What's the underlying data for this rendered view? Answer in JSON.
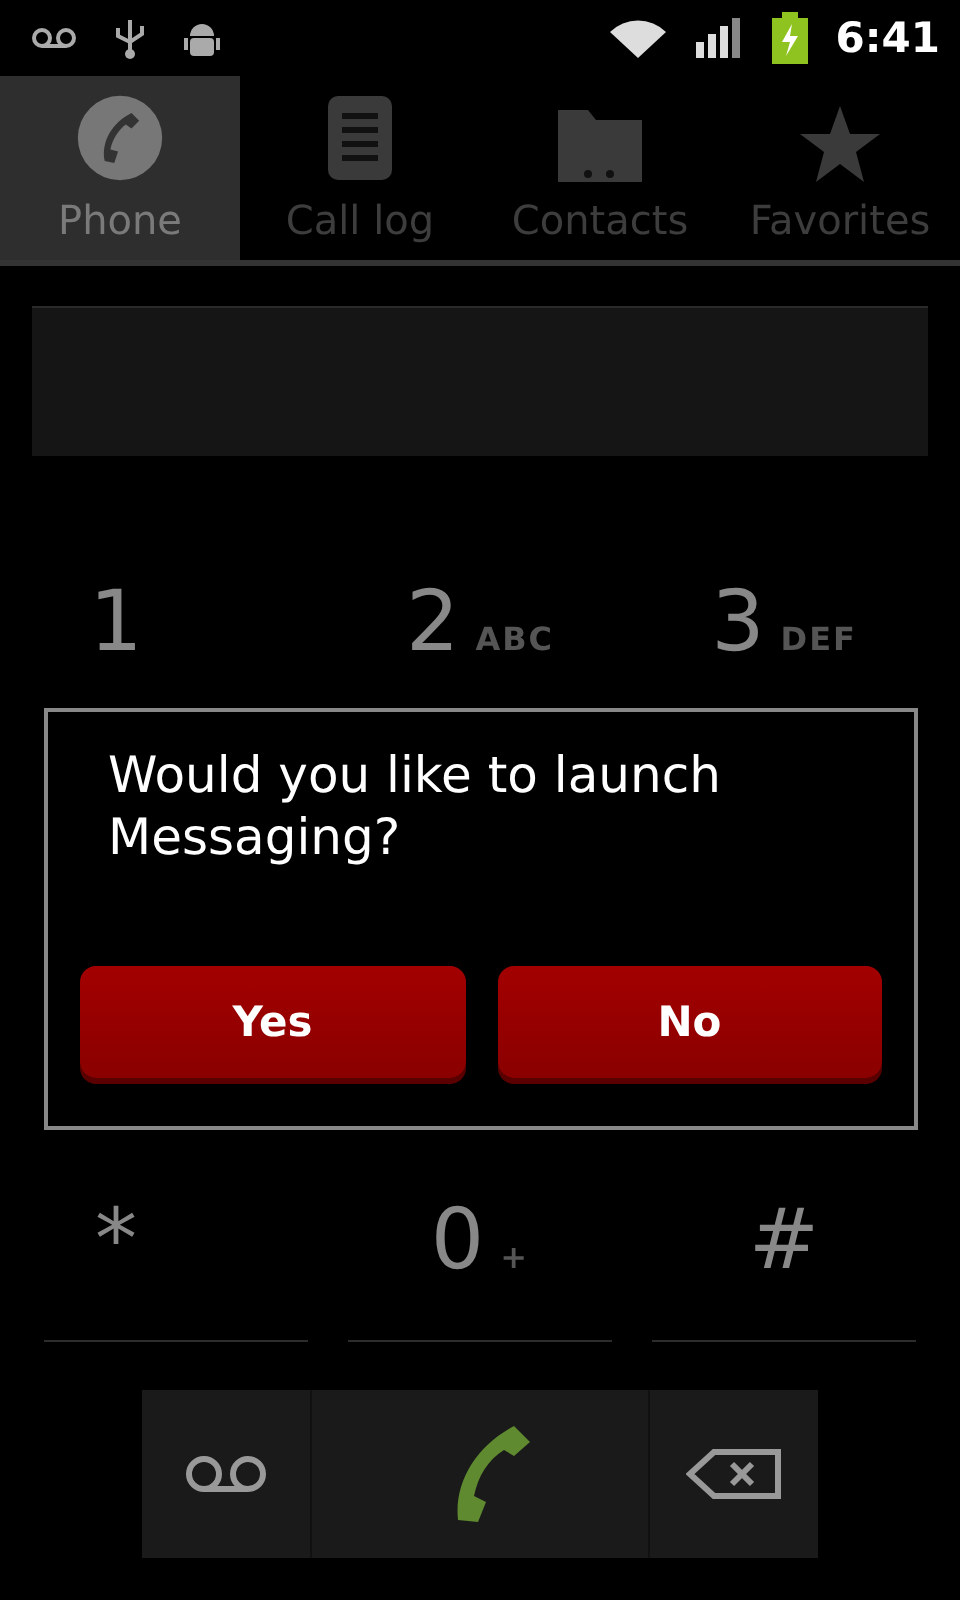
{
  "status_bar": {
    "time": "6:41"
  },
  "tabs": [
    {
      "label": "Phone",
      "selected": true
    },
    {
      "label": "Call log",
      "selected": false
    },
    {
      "label": "Contacts",
      "selected": false
    },
    {
      "label": "Favorites",
      "selected": false
    }
  ],
  "keypad": {
    "rows": [
      {
        "keys": [
          {
            "digit": "1"
          },
          {
            "digit": "2",
            "letters": "ABC"
          },
          {
            "digit": "3",
            "letters": "DEF"
          }
        ]
      },
      {
        "keys": [
          {
            "digit": "*"
          },
          {
            "digit": "0",
            "letters": "+"
          },
          {
            "digit": "#"
          }
        ]
      }
    ]
  },
  "dialog": {
    "message": "Would you like to launch Messaging?",
    "buttons": [
      "Yes",
      "No"
    ]
  }
}
